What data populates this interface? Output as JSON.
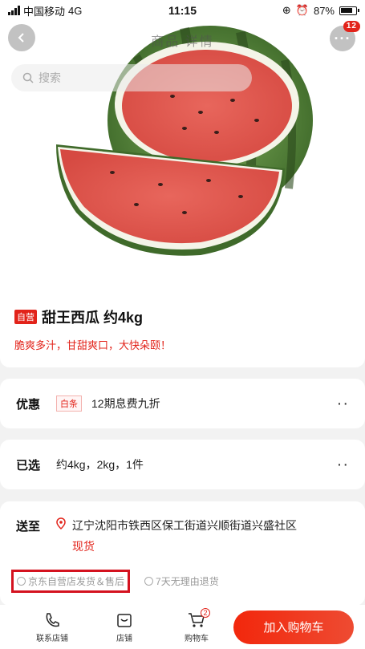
{
  "status_bar": {
    "carrier": "中国移动",
    "network": "4G",
    "time": "11:15",
    "battery": "87%"
  },
  "nav": {
    "title": "商品 详情",
    "more_badge": "12",
    "search_placeholder": "搜索"
  },
  "product": {
    "self_tag": "自营",
    "title": "甜王西瓜 约4kg",
    "subtitle": "脆爽多汁，甘甜爽口，大快朵颐！"
  },
  "promo": {
    "label": "优惠",
    "tag": "白条",
    "text": "12期息费九折"
  },
  "selected": {
    "label": "已选",
    "text": "约4kg，2kg，1件"
  },
  "shipping": {
    "label": "送至",
    "address": "辽宁沈阳市铁西区保工街道兴顺街道兴盛社区",
    "stock": "现货",
    "services": [
      "京东自营店发货＆售后",
      "7天无理由退货"
    ]
  },
  "bottom_bar": {
    "tabs": [
      {
        "label": "联系店铺",
        "icon": "phone-icon"
      },
      {
        "label": "店铺",
        "icon": "store-icon"
      },
      {
        "label": "购物车",
        "icon": "cart-icon",
        "badge": "2"
      }
    ],
    "add_to_cart": "加入购物车"
  },
  "colors": {
    "accent": "#e2231a",
    "button": "#f2270c",
    "highlight_box": "#d4121f"
  }
}
